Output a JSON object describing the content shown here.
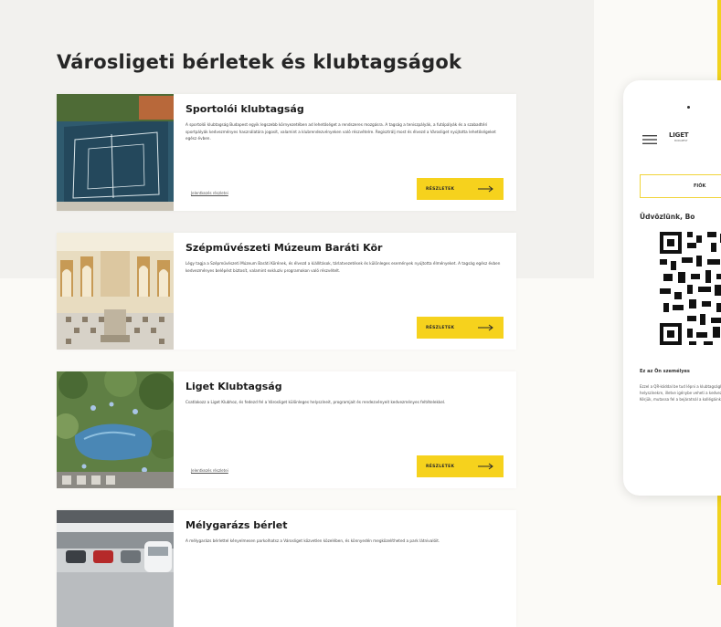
{
  "page": {
    "title": "Városligeti bérletek és klubtagságok"
  },
  "cards": [
    {
      "title": "Sportolói klubtagság",
      "description": "A sportolói klubtagság Budapest egyik legszebb környezetében ad lehetőséget a rendszeres mozgásra. A tagság a teniszpályák, a futópályák és a szabadtéri sportpályák kedvezményes használatára jogosít, valamint a klubrendezvényeken való részvételre. Regisztrálj most és élvezd a Városliget nyújtotta lehetőségeket egész évben.",
      "meta_link": "Jelentkezés részletei",
      "button_label": "RÉSZLETEK"
    },
    {
      "title": "Szépművészeti Múzeum Baráti Kör",
      "description": "Légy tagja a Szépművészeti Múzeum Baráti Körének, és élvezd a kiállítások, tárlatvezetések és különleges események nyújtotta élményeket. A tagság egész évben kedvezményes belépést biztosít, valamint exkluzív programokon való részvételt.",
      "meta_link": "",
      "button_label": "RÉSZLETEK"
    },
    {
      "title": "Liget Klubtagság",
      "description": "Csatlakozz a Liget Klubhoz, és fedezd fel a Városliget különleges helyszíneit, programjait és rendezvényeit kedvezményes feltételekkel.",
      "meta_link": "Jelentkezés részletei",
      "button_label": "RÉSZLETEK"
    },
    {
      "title": "Mélygarázs bérlet",
      "description": "A mélygarázs bérlettel kényelmesen parkolhatsz a Városliget közvetlen közelében, és könnyedén megközelítheted a park látnivalóit.",
      "meta_link": "",
      "button_label": "RÉSZLETEK"
    }
  ],
  "phone": {
    "brand": "LIGET",
    "brand_sub": "BUDAPEST",
    "account_button": "FIÓK",
    "greeting": "Üdvözlünk, Bo",
    "qr_caption": "Ez az Ön személyes",
    "qr_text": "Ezzel a QR-kóddal be tud lépni a klubtagsághoz tartozó helyszínekre, illetve igénybe veheti a kedvezményeket. Kérjük, mutassa fel a bejáratnál a kollégáinknak."
  },
  "colors": {
    "accent": "#f6d21d",
    "background": "#fbfaf7",
    "band": "#f2f1ee"
  },
  "icons": {
    "button_arrow": "arrow-right-icon",
    "menu": "hamburger-menu-icon"
  }
}
